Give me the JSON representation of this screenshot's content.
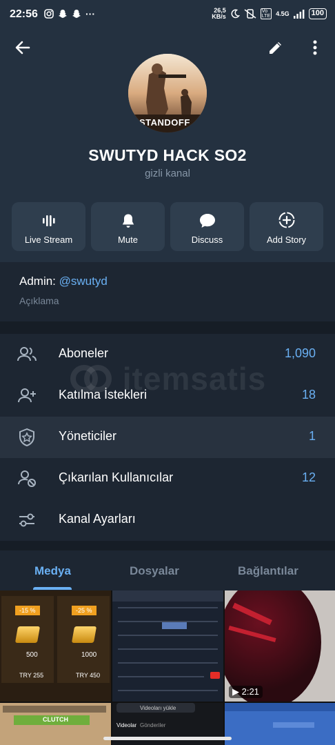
{
  "status_bar": {
    "time": "22:56",
    "speed": "26,5 KB/s",
    "network": "4.5G",
    "battery": "100"
  },
  "header": {
    "channel_name": "SWUTYD HACK SO2",
    "channel_type": "gizli kanal",
    "avatar_text": "STANDOFF"
  },
  "quick_actions": [
    {
      "label": "Live Stream",
      "icon": "live-stream-icon"
    },
    {
      "label": "Mute",
      "icon": "bell-icon"
    },
    {
      "label": "Discuss",
      "icon": "chat-bubble-icon"
    },
    {
      "label": "Add Story",
      "icon": "add-story-icon"
    }
  ],
  "info": {
    "admin_prefix": "Admin: ",
    "admin_handle": "@swutyd",
    "description_label": "Açıklama"
  },
  "list": [
    {
      "label": "Aboneler",
      "value": "1,090",
      "icon": "users-icon"
    },
    {
      "label": "Katılma İstekleri",
      "value": "18",
      "icon": "user-add-icon"
    },
    {
      "label": "Yöneticiler",
      "value": "1",
      "icon": "shield-star-icon"
    },
    {
      "label": "Çıkarılan Kullanıcılar",
      "value": "12",
      "icon": "user-block-icon"
    },
    {
      "label": "Kanal Ayarları",
      "value": "",
      "icon": "settings-sliders-icon"
    }
  ],
  "watermark": "itemsatis",
  "tabs": [
    {
      "label": "Medya",
      "active": true
    },
    {
      "label": "Dosyalar",
      "active": false
    },
    {
      "label": "Bağlantılar",
      "active": false
    }
  ],
  "media": {
    "tile1": {
      "badge_a": "-15 %",
      "badge_b": "-25 %",
      "price_a": "500",
      "price_b": "1000",
      "try_a": "TRY 255",
      "try_b": "TRY 450"
    },
    "tile3": {
      "duration": "2:21"
    },
    "tile4": {
      "text": "CLUTCH"
    },
    "tile5": {
      "input": "Videoları yükle",
      "tab_a": "Videolar",
      "tab_b": "Gönderiler"
    }
  },
  "colors": {
    "accent": "#6ab0f3",
    "background": "#1c242f",
    "header": "#243140"
  }
}
